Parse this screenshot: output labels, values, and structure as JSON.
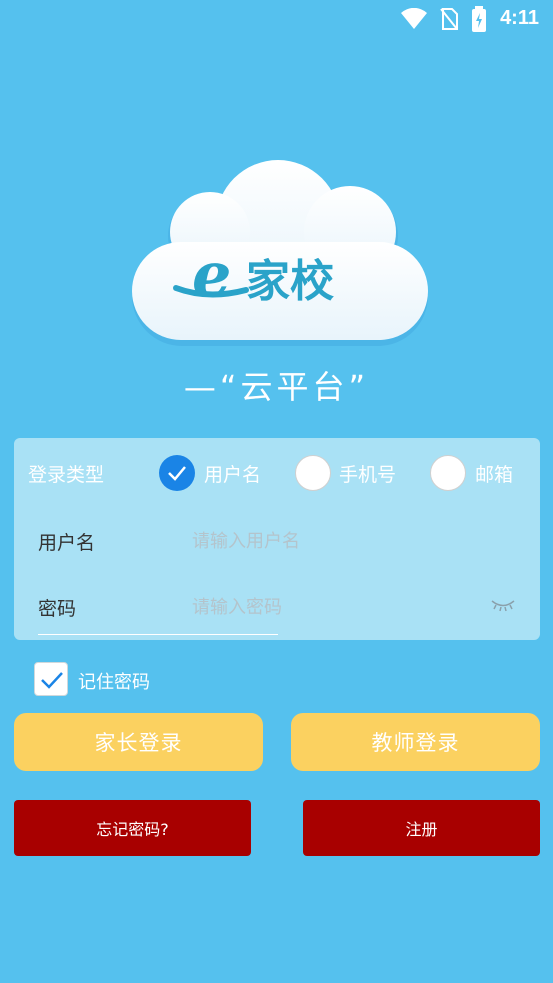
{
  "status_bar": {
    "time": "4:11"
  },
  "logo": {
    "brand_text": "家校",
    "brand_letter": "e"
  },
  "slogan": "—“云平台”",
  "login": {
    "type_label": "登录类型",
    "types": [
      {
        "label": "用户名",
        "selected": true
      },
      {
        "label": "手机号",
        "selected": false
      },
      {
        "label": "邮箱",
        "selected": false
      }
    ],
    "username": {
      "label": "用户名",
      "placeholder": "请输入用户名",
      "value": ""
    },
    "password": {
      "label": "密码",
      "placeholder": "请输入密码",
      "value": ""
    }
  },
  "remember": {
    "label": "记住密码",
    "checked": true
  },
  "buttons": {
    "parent_login": "家长登录",
    "teacher_login": "教师登录",
    "forgot_password": "忘记密码?",
    "register": "注册"
  },
  "colors": {
    "background": "#55c1ee",
    "panel": "#a9e1f5",
    "radio_selected": "#1a84e6",
    "login_button": "#fbd160",
    "secondary_button": "#a80000"
  },
  "icons": [
    "wifi-icon",
    "no-sim-icon",
    "battery-icon",
    "cloud-icon",
    "check-icon",
    "eye-closed-icon"
  ]
}
